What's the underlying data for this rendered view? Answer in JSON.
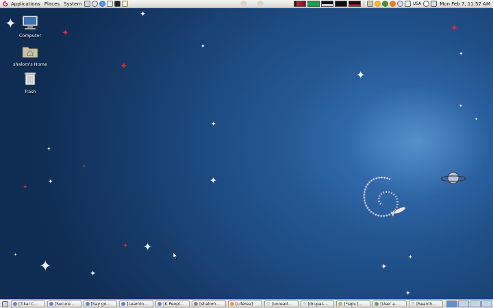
{
  "top_panel": {
    "menus": [
      "Applications",
      "Places",
      "System"
    ],
    "keyboard_layout": "USA",
    "clock": "Mon Feb  7, 11:57 AM"
  },
  "desktop": {
    "icons": [
      {
        "label": "Computer",
        "icon": "computer-icon"
      },
      {
        "label": "shalom's Home",
        "icon": "home-folder-icon"
      },
      {
        "label": "Trash",
        "icon": "trash-icon"
      }
    ]
  },
  "taskbar": {
    "items": [
      "[Tikal C...",
      "[Secure...",
      "[Say go...",
      "[Learnin...",
      "[K Peopl...",
      "[shalom...",
      "[Liferea]",
      "[unread...",
      "[drupal-...",
      "[*sqls [...",
      "[User a...",
      "[Search..."
    ],
    "workspaces": 4,
    "active_workspace": 1
  },
  "colors": {
    "desktop_base": "#1f4e86",
    "panel": "#e6e4e0",
    "accent_red": "#c0303a"
  }
}
